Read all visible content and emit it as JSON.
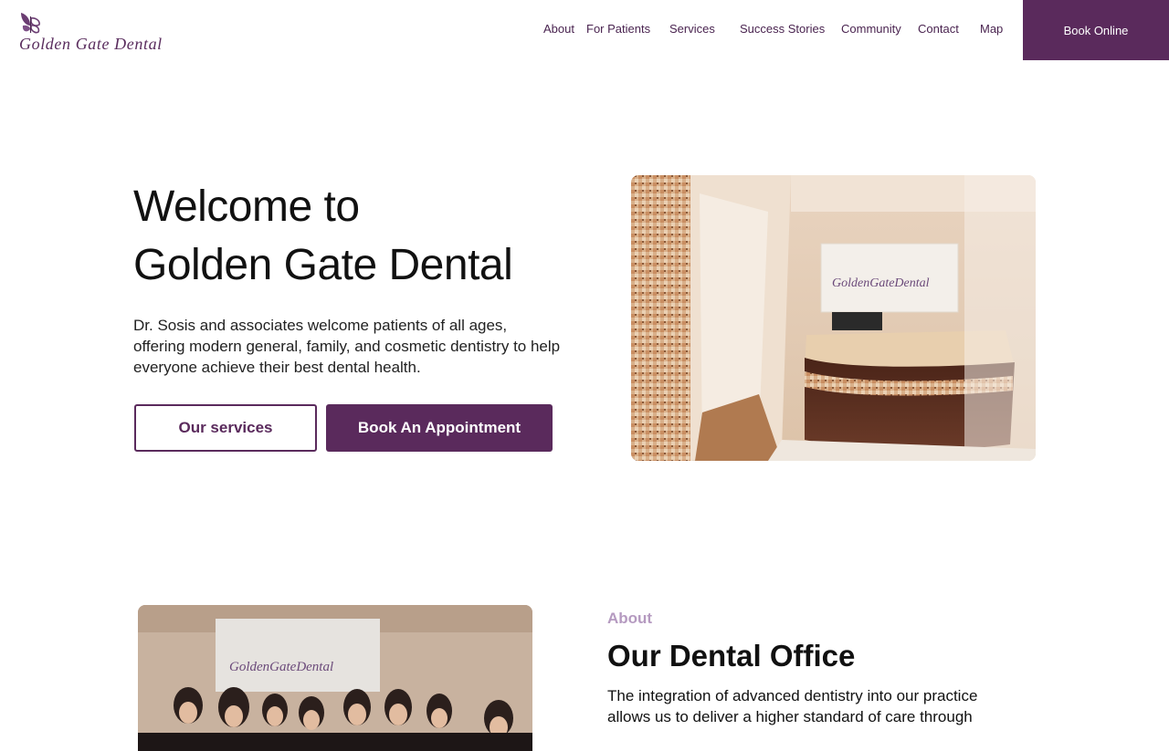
{
  "brand": {
    "name": "Golden Gate Dental",
    "logo_icon": "butterfly-icon",
    "accent_color": "#5a2a5c",
    "eyebrow_color": "#b59ac0"
  },
  "nav": {
    "items": [
      "About",
      "For Patients",
      "Services",
      "Success Stories",
      "Community",
      "Contact",
      "Map"
    ],
    "cta_label": "Book Online"
  },
  "hero": {
    "title_line1": "Welcome to",
    "title_line2": "Golden Gate Dental",
    "description": "Dr. Sosis and associates welcome patients of all ages, offering modern general, family, and cosmetic dentistry to help everyone achieve their best dental health.",
    "secondary_button": "Our services",
    "primary_button": "Book An Appointment",
    "photo_sign_text": "GoldenGateDental"
  },
  "about": {
    "eyebrow": "About",
    "title": "Our Dental Office",
    "body": "The integration of advanced dentistry into our practice allows us to deliver a higher standard of care through",
    "photo_sign_text": "GoldenGateDental"
  }
}
